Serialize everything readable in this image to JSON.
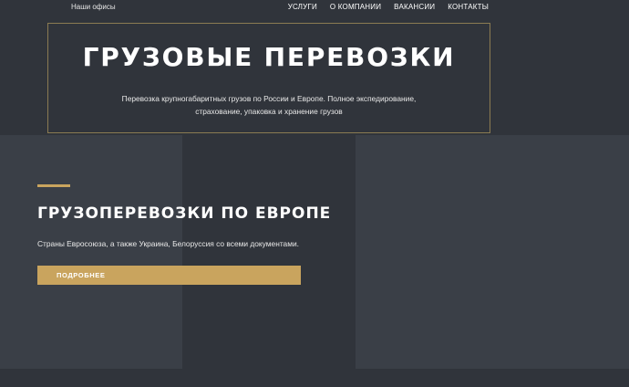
{
  "header": {
    "offices_link": "Наши офисы",
    "nav": [
      "УСЛУГИ",
      "О КОМПАНИИ",
      "ВАКАНСИИ",
      "КОНТАКТЫ"
    ]
  },
  "hero": {
    "title": "ГРУЗОВЫЕ ПЕРЕВОЗКИ",
    "subtitle_line1": "Перевозка крупногабаритных грузов по России и Европе. Полное экспедирование,",
    "subtitle_line2": "страхование, упаковка и хранение грузов"
  },
  "section": {
    "title": "ГРУЗОПЕРЕВОЗКИ ПО ЕВРОПЕ",
    "text": "Страны Евросоюза, а также Украина, Белоруссия со всеми документами.",
    "button_label": "ПОДРОБНЕЕ"
  },
  "colors": {
    "background": "#30343b",
    "panel": "#3a3f47",
    "accent": "#c9a45e"
  }
}
